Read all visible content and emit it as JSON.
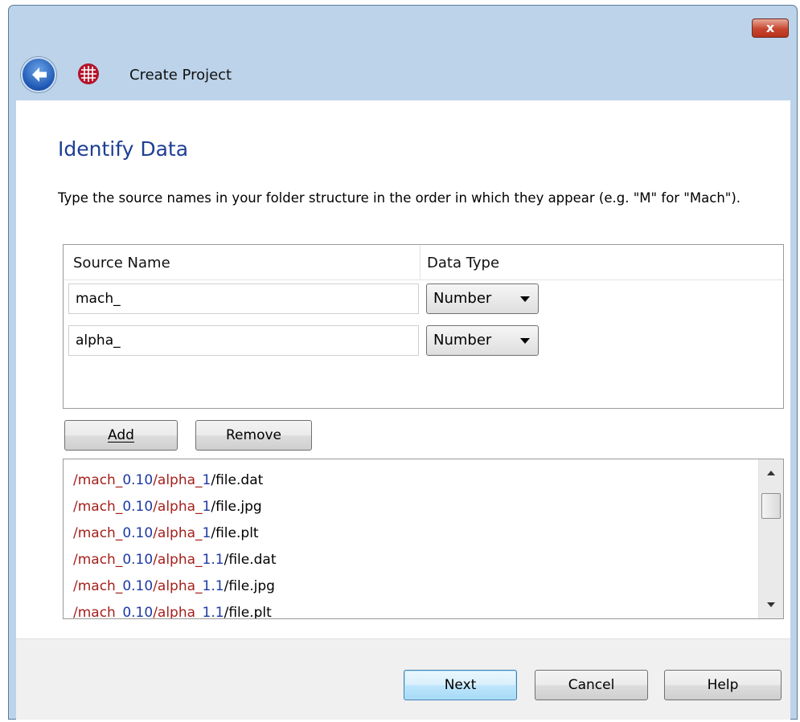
{
  "window": {
    "title": "Create Project",
    "close_label": "x"
  },
  "page": {
    "heading": "Identify Data",
    "instructions": "Type the source names in your folder structure in the order in which they appear (e.g. \"M\" for \"Mach\")."
  },
  "grid": {
    "columns": [
      "Source Name",
      "Data Type"
    ],
    "rows": [
      {
        "source_name": "mach_",
        "data_type": "Number"
      },
      {
        "source_name": "alpha_",
        "data_type": "Number"
      }
    ]
  },
  "actions": {
    "add_label": "Add",
    "remove_label": "Remove"
  },
  "file_list": [
    {
      "p1": "/mach_",
      "v1": "0.10",
      "p2": "/alpha_",
      "v2": "1",
      "rest": "/file.dat"
    },
    {
      "p1": "/mach_",
      "v1": "0.10",
      "p2": "/alpha_",
      "v2": "1",
      "rest": "/file.jpg"
    },
    {
      "p1": "/mach_",
      "v1": "0.10",
      "p2": "/alpha_",
      "v2": "1",
      "rest": "/file.plt"
    },
    {
      "p1": "/mach_",
      "v1": "0.10",
      "p2": "/alpha_",
      "v2": "1.1",
      "rest": "/file.dat"
    },
    {
      "p1": "/mach_",
      "v1": "0.10",
      "p2": "/alpha_",
      "v2": "1.1",
      "rest": "/file.jpg"
    },
    {
      "p1": "/mach_",
      "v1": "0.10",
      "p2": "/alpha_",
      "v2": "1.1",
      "rest": "/file.plt"
    }
  ],
  "footer": {
    "next_label": "Next",
    "cancel_label": "Cancel",
    "help_label": "Help"
  },
  "colors": {
    "path_red": "#a4201c",
    "value_blue": "#1e3aa6",
    "heading_blue": "#1e3f94"
  },
  "icons": [
    "back-arrow-icon",
    "app-grid-icon",
    "close-icon",
    "dropdown-arrow-icon",
    "scroll-up-icon",
    "scroll-down-icon"
  ]
}
